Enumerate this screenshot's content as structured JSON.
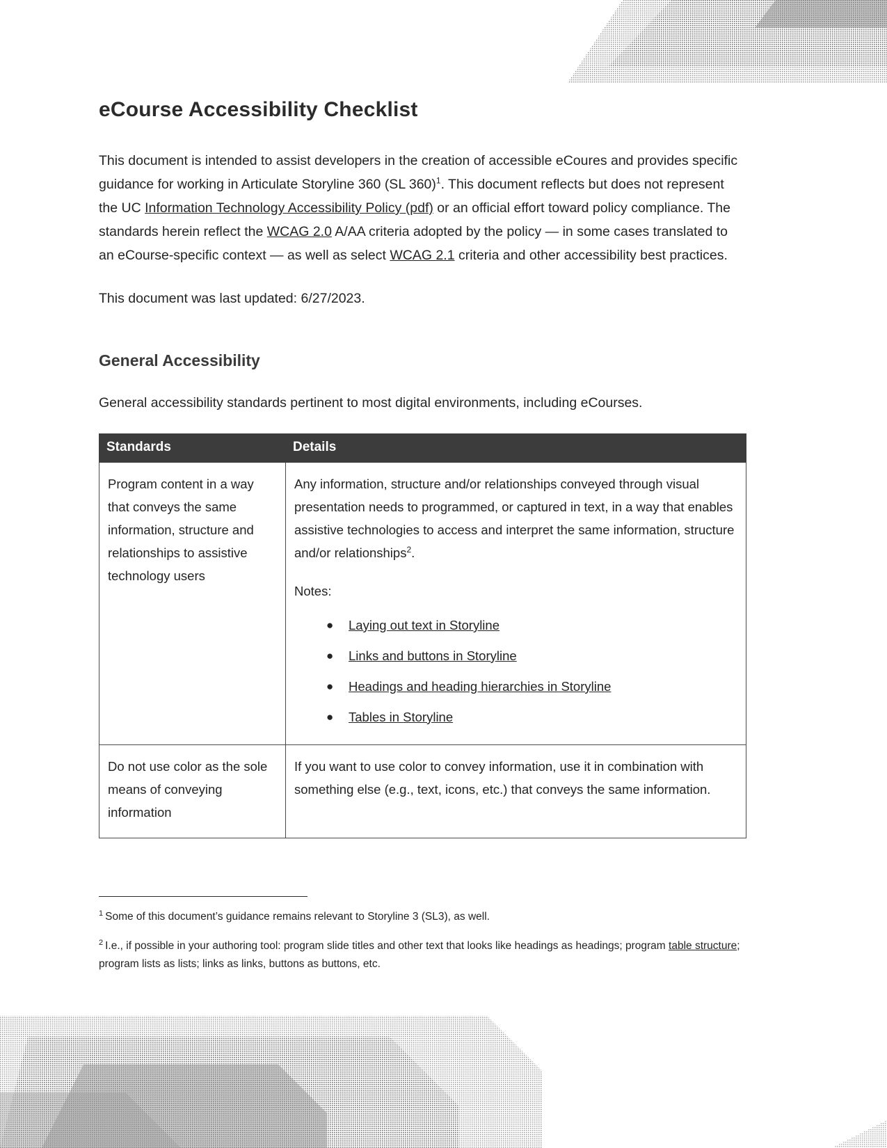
{
  "document": {
    "title": "eCourse Accessibility Checklist",
    "intro_paragraph": {
      "seg1": "This document is intended to assist developers in the creation of accessible eCoures and provides specific guidance for working in Articulate Storyline 360 (SL 360)",
      "footnote_marker_1": "1",
      "seg2": ". This document reflects but does not represent the UC ",
      "link_policy": "Information Technology Accessibility Policy (pdf)",
      "seg3": " or an official effort toward policy compliance. The standards herein reflect the ",
      "link_wcag20": "WCAG 2.0",
      "seg4": " A/AA criteria adopted by the policy — in some cases translated to an eCourse-specific context — as well as select ",
      "link_wcag21": "WCAG 2.1",
      "seg5": " criteria and other accessibility best practices."
    },
    "last_updated": "This document was last updated: 6/27/2023."
  },
  "section": {
    "heading": "General Accessibility",
    "intro": "General accessibility standards pertinent to most digital environments, including eCourses."
  },
  "table": {
    "headers": [
      "Standards",
      "Details"
    ],
    "rows": [
      {
        "standard": "Program content in a way that conveys the same information, structure and relationships to assistive technology users",
        "details_p1_a": "Any information, structure and/or relationships conveyed through visual presentation needs to programmed, or captured in text, in a way that enables assistive technologies to access and interpret the same information, structure and/or relationships",
        "details_p1_footnote": "2",
        "details_p1_b": ".",
        "notes_label": "Notes:",
        "notes": [
          "Laying out text in Storyline",
          "Links and buttons in Storyline",
          "Headings and heading hierarchies in Storyline",
          "Tables in Storyline"
        ],
        "bullet_glyph": "●"
      },
      {
        "standard": "Do not use color as the sole means of conveying information",
        "details": "If you want to use color to convey information, use it in combination with something else (e.g., text, icons, etc.) that conveys the same information."
      }
    ]
  },
  "footnotes": [
    {
      "marker": "1",
      "text": "Some of this document’s guidance remains relevant to Storyline 3 (SL3), as well."
    },
    {
      "marker": "2",
      "seg1": "I.e., if possible in your authoring tool: program slide titles and other text that looks like headings as headings; program ",
      "link": "table structure",
      "seg2": "; program lists as lists; links as links, buttons as buttons, etc."
    }
  ],
  "colors": {
    "table_header_bg": "#3c3c3c",
    "table_header_text": "#ffffff",
    "body_text": "#242424",
    "heading_text": "#3a3a3a"
  }
}
